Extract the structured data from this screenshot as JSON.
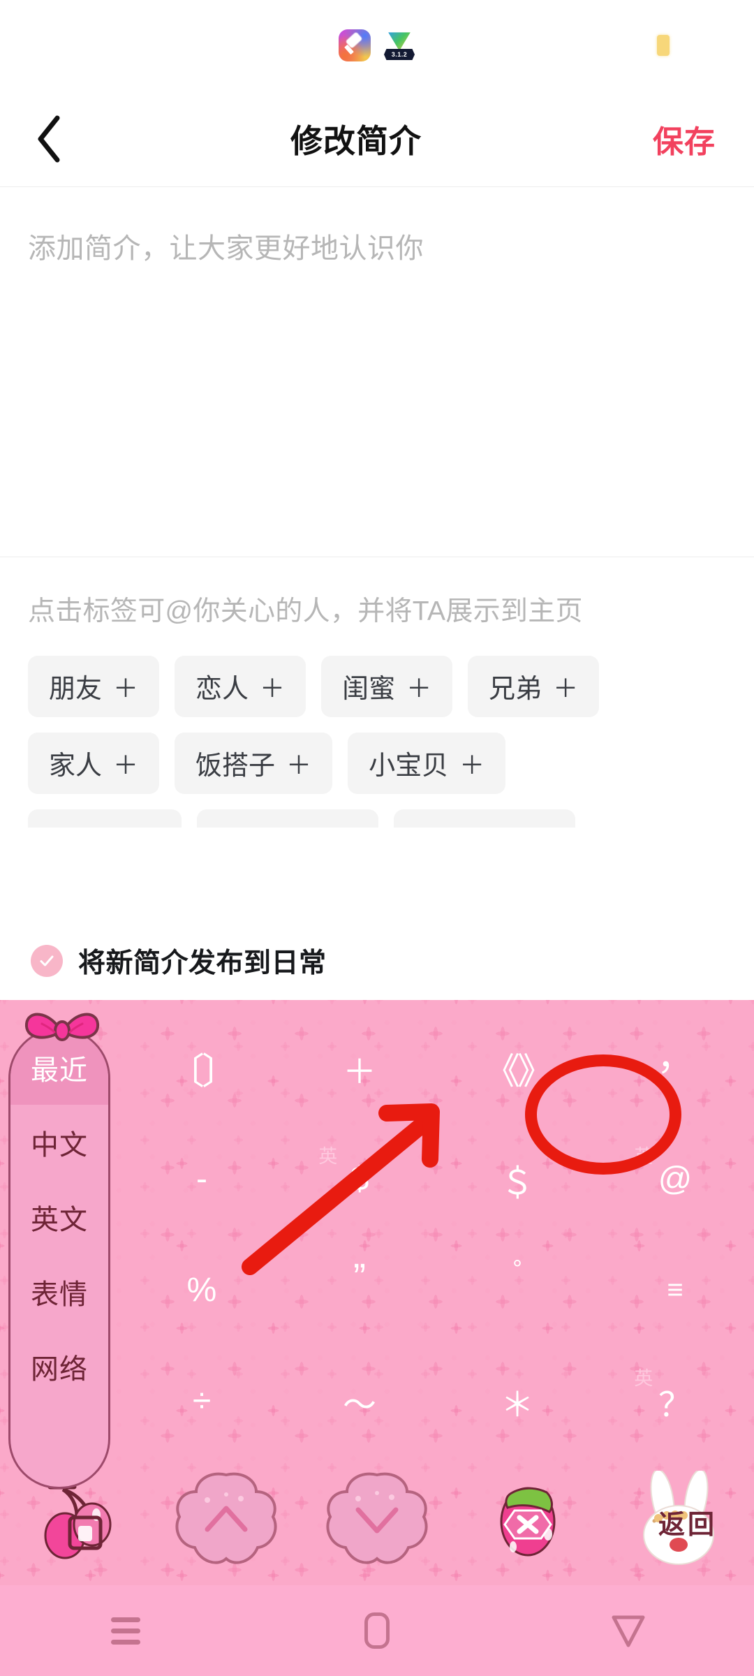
{
  "status_bar": {
    "left_icons": [
      {
        "name": "app-icon-gradient",
        "label": ""
      },
      {
        "name": "video-app-icon",
        "label": "3.1.2"
      }
    ],
    "right_icons": [
      {
        "name": "battery-icon",
        "label": ""
      }
    ]
  },
  "header": {
    "back_label": "‹",
    "title": "修改简介",
    "save_label": "保存",
    "save_color": "#f2415e"
  },
  "bio": {
    "value": "",
    "placeholder": "添加简介，让大家更好地认识你"
  },
  "tags": {
    "hint": "点击标签可@你关心的人，并将TA展示到主页",
    "plus": "＋",
    "rows": [
      [
        {
          "label": "朋友"
        },
        {
          "label": "恋人"
        },
        {
          "label": "闺蜜"
        },
        {
          "label": "兄弟"
        }
      ],
      [
        {
          "label": "家人"
        },
        {
          "label": "饭搭子"
        },
        {
          "label": "小宝贝"
        }
      ]
    ]
  },
  "publish": {
    "label": "将新简介发布到日常",
    "checked": true,
    "check_color": "#f8b6c8"
  },
  "keyboard": {
    "background_color": "#fba9c9",
    "sidebar": [
      {
        "label": "最近",
        "active": true
      },
      {
        "label": "中文",
        "active": false
      },
      {
        "label": "英文",
        "active": false
      },
      {
        "label": "表情",
        "active": false
      },
      {
        "label": "网络",
        "active": false
      }
    ],
    "keys": [
      {
        "label": "〔〕",
        "hint": "",
        "style": "sym-bracket"
      },
      {
        "label": "＋",
        "hint": "",
        "style": ""
      },
      {
        "label": "《》",
        "hint": "",
        "style": "sym-bracket"
      },
      {
        "label": "，",
        "hint": "",
        "style": "sym-comma"
      },
      {
        "label": "-",
        "hint": "",
        "style": ""
      },
      {
        "label": "$",
        "hint": "英",
        "style": ""
      },
      {
        "label": "＄",
        "hint": "",
        "style": ""
      },
      {
        "label": "@",
        "hint": "英",
        "style": ""
      },
      {
        "label": "%",
        "hint": "",
        "style": ""
      },
      {
        "label": "”",
        "hint": "",
        "style": "sym-quote"
      },
      {
        "label": "°",
        "hint": "",
        "style": "sym-deg"
      },
      {
        "label": "≡",
        "hint": "",
        "style": "sym-menu"
      },
      {
        "label": "÷",
        "hint": "",
        "style": ""
      },
      {
        "label": "～",
        "hint": "",
        "style": ""
      },
      {
        "label": "＊",
        "hint": "",
        "style": ""
      },
      {
        "label": "？",
        "hint": "英",
        "style": ""
      }
    ],
    "function_row": [
      {
        "name": "cherry-sticker-key",
        "label": ""
      },
      {
        "name": "page-up-key",
        "label": "∧"
      },
      {
        "name": "page-down-key",
        "label": "∨"
      },
      {
        "name": "delete-key",
        "label": "✕"
      },
      {
        "name": "return-key",
        "label": "返回"
      }
    ]
  },
  "annotations": {
    "highlight_color": "#e81b10",
    "circled_key": "@",
    "arrow": "points-to-at-key"
  },
  "nav_bar": {
    "background_color": "#fdaed0",
    "buttons": [
      {
        "name": "recents-button"
      },
      {
        "name": "home-button"
      },
      {
        "name": "back-button"
      }
    ]
  }
}
